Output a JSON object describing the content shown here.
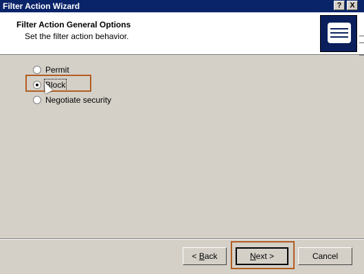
{
  "window": {
    "title": "Filter Action Wizard",
    "help_glyph": "?",
    "close_glyph": "X"
  },
  "header": {
    "title": "Filter Action General Options",
    "subtitle": "Set the filter action behavior.",
    "art_icon": "wizard-scroll-icon"
  },
  "options": [
    {
      "label": "Permit",
      "checked": false
    },
    {
      "label": "Block",
      "checked": true
    },
    {
      "label": "Negotiate security",
      "checked": false
    }
  ],
  "buttons": {
    "back": {
      "prefix": "< ",
      "hotkey": "B",
      "rest": "ack"
    },
    "next": {
      "hotkey": "N",
      "rest": "ext >"
    },
    "cancel": "Cancel"
  },
  "colors": {
    "titlebar": "#0a246a",
    "highlight": "#b25c1f",
    "dialog_bg": "#d4d0c8"
  }
}
